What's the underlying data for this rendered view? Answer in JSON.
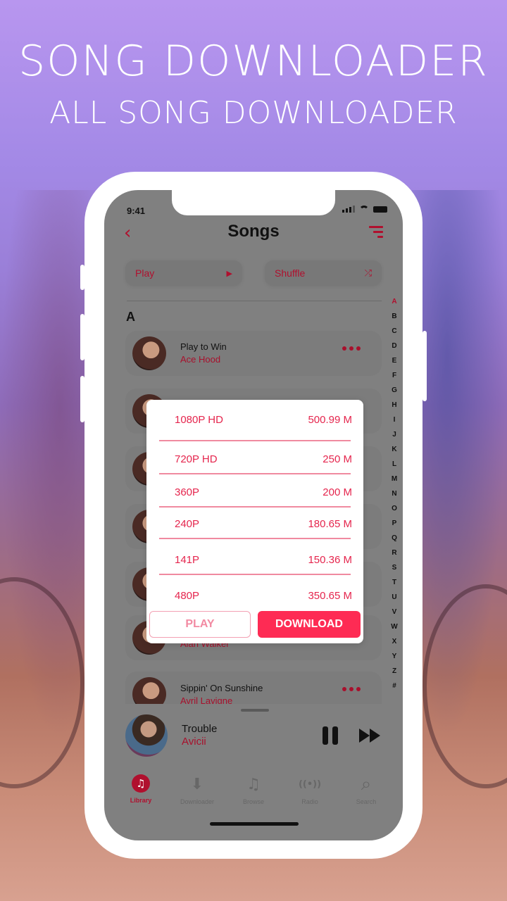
{
  "banner": {
    "headline": "SONG DOWNLOADER",
    "subheadline": "ALL SONG DOWNLOADER"
  },
  "status_bar": {
    "time": "9:41"
  },
  "nav": {
    "back_icon": "chevron-left-icon",
    "title": "Songs",
    "filter_icon": "filter-icon"
  },
  "actions": {
    "play_label": "Play",
    "play_icon": "▶",
    "shuffle_label": "Shuffle",
    "shuffle_icon": "⤮"
  },
  "section": {
    "letter": "A"
  },
  "alphabet": [
    "A",
    "B",
    "C",
    "D",
    "E",
    "F",
    "G",
    "H",
    "I",
    "J",
    "K",
    "L",
    "M",
    "N",
    "O",
    "P",
    "Q",
    "R",
    "S",
    "T",
    "U",
    "V",
    "W",
    "X",
    "Y",
    "Z",
    "#"
  ],
  "alphabet_active": "A",
  "songs": [
    {
      "title": "Play to Win",
      "artist": "Ace Hood"
    },
    {
      "title": "",
      "artist": ""
    },
    {
      "title": "",
      "artist": ""
    },
    {
      "title": "",
      "artist": ""
    },
    {
      "title": "",
      "artist": ""
    },
    {
      "title": "",
      "artist": "Alan Walker"
    },
    {
      "title": "Sippin' On Sunshine",
      "artist": "Avril Lavigne"
    }
  ],
  "download_modal": {
    "options": [
      {
        "quality": "1080P HD",
        "size": "500.99 M"
      },
      {
        "quality": "720P HD",
        "size": "250 M"
      },
      {
        "quality": "360P",
        "size": "200 M"
      },
      {
        "quality": "240P",
        "size": "180.65 M"
      },
      {
        "quality": "141P",
        "size": "150.36 M"
      },
      {
        "quality": "480P",
        "size": "350.65 M"
      }
    ],
    "play_label": "PLAY",
    "download_label": "DOWNLOAD"
  },
  "now_playing": {
    "title": "Trouble",
    "artist": "Avicii"
  },
  "tabs": [
    {
      "label": "Library",
      "icon": "♫",
      "active": true
    },
    {
      "label": "Downloader",
      "icon": "⬇",
      "active": false
    },
    {
      "label": "Browse",
      "icon": "♫",
      "active": false
    },
    {
      "label": "Radio",
      "icon": "((•))",
      "active": false
    },
    {
      "label": "Search",
      "icon": "⌕",
      "active": false
    }
  ],
  "colors": {
    "accent": "#b0102e",
    "modal_accent": "#e5254d",
    "download_button": "#fe2b54"
  }
}
